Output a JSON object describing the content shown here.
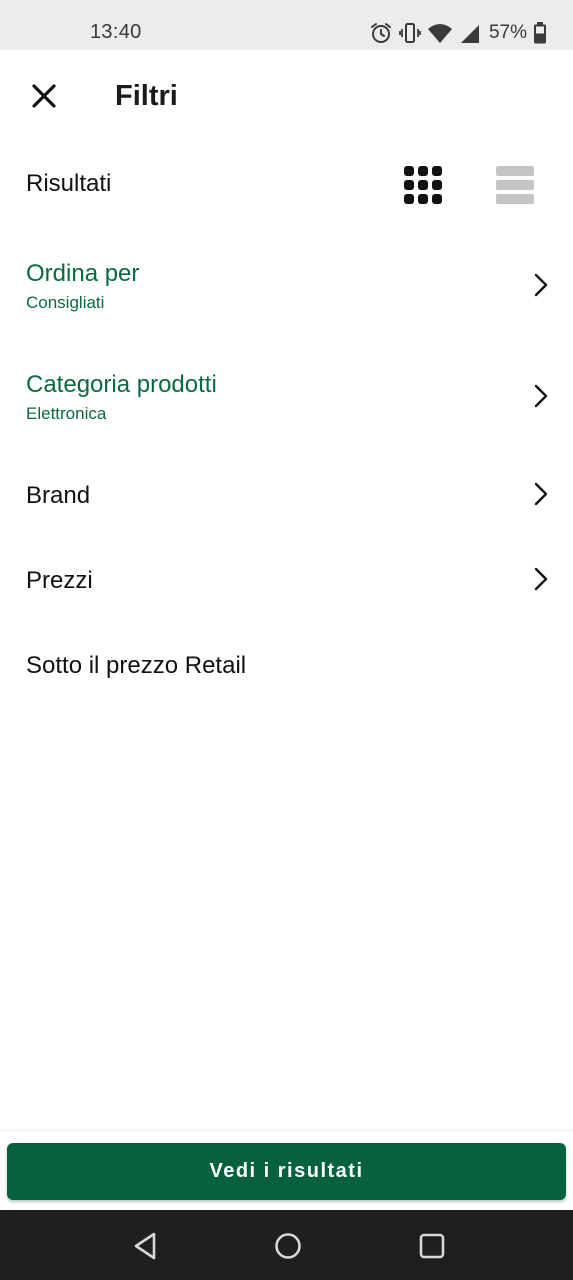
{
  "status_bar": {
    "time": "13:40",
    "battery_percent": "57%",
    "icons": [
      "alarm-icon",
      "vibrate-icon",
      "wifi-icon",
      "signal-icon",
      "battery-icon"
    ]
  },
  "header": {
    "title": "Filtri",
    "close_icon": "close-icon"
  },
  "results": {
    "label": "Risultati",
    "view_modes": [
      {
        "name": "grid-view-icon",
        "active": true
      },
      {
        "name": "list-view-icon",
        "active": false
      }
    ]
  },
  "filters": [
    {
      "title": "Ordina per",
      "subtitle": "Consigliati",
      "highlighted": true,
      "has_chevron": true
    },
    {
      "title": "Categoria prodotti",
      "subtitle": "Elettronica",
      "highlighted": true,
      "has_chevron": true
    },
    {
      "title": "Brand",
      "subtitle": "",
      "highlighted": false,
      "has_chevron": true
    },
    {
      "title": "Prezzi",
      "subtitle": "",
      "highlighted": false,
      "has_chevron": true
    },
    {
      "title": "Sotto il prezzo Retail",
      "subtitle": "",
      "highlighted": false,
      "has_chevron": false
    }
  ],
  "cta": {
    "label": "Vedi i risultati"
  },
  "colors": {
    "accent": "#0b6a3f",
    "button": "#05623d",
    "status_bar": "#ececec",
    "nav_bar": "#1f1f1f"
  },
  "nav_bar": {
    "buttons": [
      "back-icon",
      "home-icon",
      "recents-icon"
    ]
  }
}
